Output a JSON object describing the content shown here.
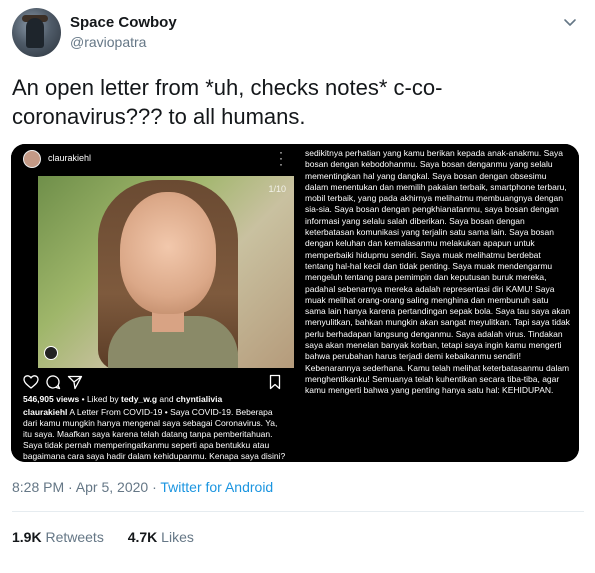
{
  "user": {
    "display_name": "Space Cowboy",
    "handle": "@raviopatra",
    "menu_icon": "chevron-down-icon"
  },
  "tweet": {
    "text": "An open letter from *uh, checks notes* c-co-coronavirus??? to all humans."
  },
  "media": {
    "instagram": {
      "username": "claurakiehl",
      "photo_counter": "1/10",
      "views": "546,905 views",
      "liked_by_prefix": " • Liked by ",
      "liked_user_1": "tedy_w.g",
      "liked_and": " and ",
      "liked_user_2": "chyntialivia",
      "caption_user": "claurakiehl",
      "caption_text": " A Letter From COVID-19 • Saya COVID-19. Beberapa dari kamu mungkin hanya mengenal saya sebagai Coronavirus. Ya, itu saya. Maafkan saya karena telah datang tanpa pemberitahuan. Saya tidak pernah memperingatkanmu seperti apa bentukku atau bagaimana cara saya hadir dalam kehidupanmu. Kenapa saya disini? Sederhananya, saya bosan melihat kemunduran perilaku yang menyimpang dari"
    },
    "letter_text": "sedikitnya perhatian yang kamu berikan kepada anak-anakmu. Saya bosan dengan kebodohanmu. Saya bosan denganmu yang selalu mementingkan hal yang dangkal. Saya bosan dengan obsesimu dalam menentukan dan memilih pakaian terbaik, smartphone terbaru, mobil terbaik, yang pada akhirnya melihatmu membuangnya dengan sia-sia. Saya bosan dengan pengkhianatanmu, saya bosan dengan informasi yang selalu salah diberikan. Saya bosan dengan keterbatasan komunikasi yang terjalin satu sama lain. Saya bosan dengan keluhan dan kemalasanmu melakukan apapun untuk memperbaiki hidupmu sendiri. Saya muak melihatmu berdebat tentang hal-hal kecil dan tidak penting. Saya muak mendengarmu mengeluh tentang para pemimpin dan keputusan buruk mereka, padahal sebenarnya mereka adalah representasi diri KAMU! Saya muak melihat orang-orang saling menghina dan membunuh satu sama lain hanya karena pertandingan sepak bola. Saya tau saya akan menyulitkan, bahkan mungkin akan sangat meyulitkan. Tapi saya tidak perlu berhadapan langsung denganmu. Saya adalah virus. Tindakan saya akan menelan banyak korban, tetapi saya ingin kamu mengerti bahwa perubahan harus terjadi demi kebaikanmu sendiri! Kebenarannya sederhana. Kamu telah melihat keterbatasanmu dalam menghentikanku! Semuanya telah kuhentikan secara tiba-tiba, agar kamu mengerti bahwa yang penting hanya satu hal: KEHIDUPAN."
  },
  "meta": {
    "time": "8:28 PM · Apr 5, 2020 · ",
    "source": "Twitter for Android"
  },
  "stats": {
    "retweets_count": "1.9K",
    "retweets_label": " Retweets",
    "likes_count": "4.7K",
    "likes_label": " Likes"
  },
  "colors": {
    "accent": "#1b95e0",
    "secondary_text": "#657786",
    "primary_text": "#14171a",
    "divider": "#e6ecf0"
  }
}
